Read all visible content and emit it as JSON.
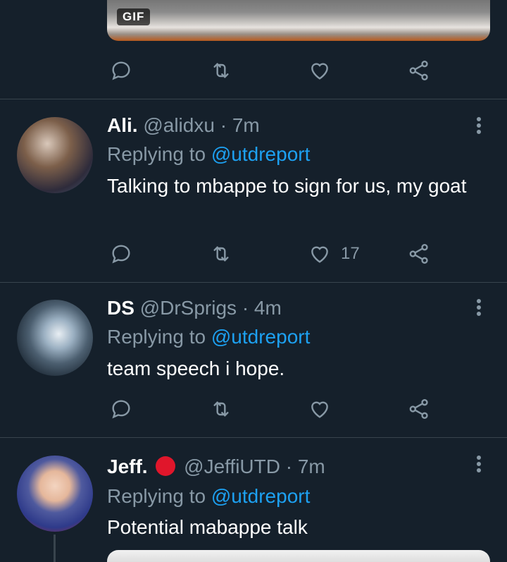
{
  "top_media": {
    "badge": "GIF"
  },
  "tweets": [
    {
      "name": "Ali.",
      "handle": "@alidxu",
      "time": "7m",
      "replying_label": "Replying to",
      "replying_to": "@utdreport",
      "text": "Talking to mbappe to sign for us, my goat",
      "like_count": "17"
    },
    {
      "name": "DS",
      "handle": "@DrSprigs",
      "time": "4m",
      "replying_label": "Replying to",
      "replying_to": "@utdreport",
      "text": "team speech i hope.",
      "like_count": ""
    },
    {
      "name": "Jeff.",
      "handle": "@JeffiUTD",
      "time": "7m",
      "replying_label": "Replying to",
      "replying_to": "@utdreport",
      "text": "Potential mabappe talk"
    }
  ],
  "separator": "·",
  "colors": {
    "background": "#15202b",
    "secondary_text": "#8899a6",
    "link": "#1da1f2",
    "divider": "#38444d",
    "badge_red": "#e0162b"
  }
}
